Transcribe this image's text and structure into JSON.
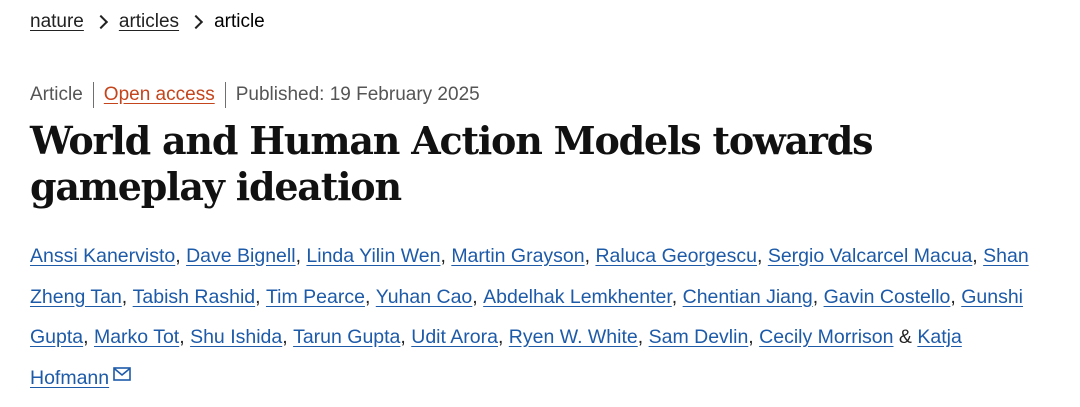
{
  "breadcrumb": {
    "items": [
      {
        "label": "nature"
      },
      {
        "label": "articles"
      },
      {
        "label": "article"
      }
    ]
  },
  "article_meta": {
    "type": "Article",
    "access": "Open access",
    "published": "Published: 19 February 2025"
  },
  "article": {
    "title": "World and Human Action Models towards gameplay ideation"
  },
  "authors": {
    "list": [
      "Anssi Kanervisto",
      "Dave Bignell",
      "Linda Yilin Wen",
      "Martin Grayson",
      "Raluca Georgescu",
      "Sergio Valcarcel Macua",
      "Shan Zheng Tan",
      "Tabish Rashid",
      "Tim Pearce",
      "Yuhan Cao",
      "Abdelhak Lemkhenter",
      "Chentian Jiang",
      "Gavin Costello",
      "Gunshi Gupta",
      "Marko Tot",
      "Shu Ishida",
      "Tarun Gupta",
      "Udit Arora",
      "Ryen W. White",
      "Sam Devlin",
      "Cecily Morrison",
      "Katja Hofmann"
    ],
    "separator": ",",
    "final_separator": "&",
    "contact_icon": "mail-icon"
  },
  "colors": {
    "link": "#1d5aa8",
    "open_access": "#c4441c",
    "meta_text": "#555555",
    "title_text": "#111111"
  }
}
